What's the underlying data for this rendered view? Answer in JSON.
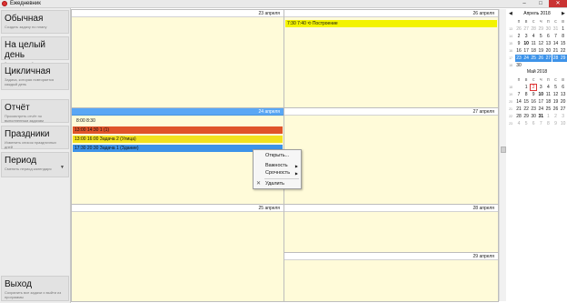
{
  "window": {
    "title": "Ежедневник",
    "min_label": "–",
    "max_label": "□",
    "close_label": "✕"
  },
  "sidebar": {
    "items": [
      {
        "title": "Обычная",
        "subtitle": "Создать задачу по плану"
      },
      {
        "title": "На целый день",
        "subtitle": "Задача на целый день"
      },
      {
        "title": "Цикличная",
        "subtitle": "Задача, которая повторяется каждый день"
      },
      {
        "title": "Отчёт",
        "subtitle": "Просмотреть отчёт по выполненным задачам"
      },
      {
        "title": "Праздники",
        "subtitle": "Изменить список праздничных дней"
      },
      {
        "title": "Период",
        "subtitle": "Сменить период календаря",
        "arrow": "▼"
      },
      {
        "title": "Выход",
        "subtitle": "Сохранить все задачи и выйти из программы"
      }
    ]
  },
  "days": {
    "d23": {
      "label": "23 апреля"
    },
    "d24": {
      "label": "24 апреля",
      "time_range": "8:00   8:30",
      "tasks": [
        {
          "text": "13:00 14:30 1 (1)",
          "color": "#e0542a"
        },
        {
          "text": "13:00 16:00 Задача 2 (Улица)",
          "color": "#f2e21f"
        },
        {
          "text": "17:30 20:30 Задача 1 (Здание)",
          "color": "#3d93e9"
        }
      ]
    },
    "d25": {
      "label": "25 апреля"
    },
    "d26": {
      "label": "26 апреля",
      "tasks": [
        {
          "text": "7:30   7:40 ⟲ Построение",
          "color": "#f3f300"
        }
      ]
    },
    "d27": {
      "label": "27 апреля"
    },
    "d28": {
      "label": "28 апреля"
    },
    "d29": {
      "label": "29 апреля"
    }
  },
  "context_menu": {
    "open": "Открыть...",
    "importance": "Важность",
    "urgency": "Срочность",
    "delete": "Удалить",
    "submenu_arrow": "▶",
    "delete_icon": "✕"
  },
  "mini_calendars": [
    {
      "title": "Апрель 2018",
      "prev": "◀",
      "next": "▶",
      "dow": [
        "п",
        "в",
        "с",
        "ч",
        "п",
        "с",
        "в"
      ],
      "weeks": [
        {
          "wk": "13",
          "days": [
            {
              "d": "26",
              "s": "gray"
            },
            {
              "d": "27",
              "s": "gray"
            },
            {
              "d": "28",
              "s": "gray"
            },
            {
              "d": "29",
              "s": "gray"
            },
            {
              "d": "30",
              "s": "gray"
            },
            {
              "d": "31",
              "s": "gray"
            },
            {
              "d": "1",
              "s": ""
            }
          ]
        },
        {
          "wk": "14",
          "days": [
            {
              "d": "2",
              "s": ""
            },
            {
              "d": "3",
              "s": ""
            },
            {
              "d": "4",
              "s": ""
            },
            {
              "d": "5",
              "s": ""
            },
            {
              "d": "6",
              "s": ""
            },
            {
              "d": "7",
              "s": ""
            },
            {
              "d": "8",
              "s": ""
            }
          ]
        },
        {
          "wk": "15",
          "days": [
            {
              "d": "9",
              "s": ""
            },
            {
              "d": "10",
              "s": "bold"
            },
            {
              "d": "11",
              "s": ""
            },
            {
              "d": "12",
              "s": ""
            },
            {
              "d": "13",
              "s": ""
            },
            {
              "d": "14",
              "s": ""
            },
            {
              "d": "15",
              "s": ""
            }
          ]
        },
        {
          "wk": "16",
          "days": [
            {
              "d": "16",
              "s": ""
            },
            {
              "d": "17",
              "s": ""
            },
            {
              "d": "18",
              "s": ""
            },
            {
              "d": "19",
              "s": ""
            },
            {
              "d": "20",
              "s": ""
            },
            {
              "d": "21",
              "s": ""
            },
            {
              "d": "22",
              "s": ""
            }
          ]
        },
        {
          "wk": "17",
          "days": [
            {
              "d": "23",
              "s": "sel"
            },
            {
              "d": "24",
              "s": "sel"
            },
            {
              "d": "25",
              "s": "sel"
            },
            {
              "d": "26",
              "s": "sel"
            },
            {
              "d": "27",
              "s": "sel"
            },
            {
              "d": "28",
              "s": "sel"
            },
            {
              "d": "29",
              "s": "sel"
            }
          ]
        },
        {
          "wk": "18",
          "days": [
            {
              "d": "30",
              "s": ""
            }
          ]
        }
      ]
    },
    {
      "title": "Май 2018",
      "dow": [
        "п",
        "в",
        "с",
        "ч",
        "п",
        "с",
        "в"
      ],
      "weeks": [
        {
          "wk": "18",
          "days": [
            {
              "d": "",
              "s": ""
            },
            {
              "d": "1",
              "s": ""
            },
            {
              "d": "2",
              "s": "today"
            },
            {
              "d": "3",
              "s": ""
            },
            {
              "d": "4",
              "s": ""
            },
            {
              "d": "5",
              "s": ""
            },
            {
              "d": "6",
              "s": ""
            }
          ]
        },
        {
          "wk": "19",
          "days": [
            {
              "d": "7",
              "s": ""
            },
            {
              "d": "8",
              "s": ""
            },
            {
              "d": "9",
              "s": ""
            },
            {
              "d": "10",
              "s": "bold"
            },
            {
              "d": "11",
              "s": ""
            },
            {
              "d": "12",
              "s": ""
            },
            {
              "d": "13",
              "s": ""
            }
          ]
        },
        {
          "wk": "20",
          "days": [
            {
              "d": "14",
              "s": ""
            },
            {
              "d": "15",
              "s": ""
            },
            {
              "d": "16",
              "s": ""
            },
            {
              "d": "17",
              "s": ""
            },
            {
              "d": "18",
              "s": ""
            },
            {
              "d": "19",
              "s": ""
            },
            {
              "d": "20",
              "s": ""
            }
          ]
        },
        {
          "wk": "21",
          "days": [
            {
              "d": "21",
              "s": ""
            },
            {
              "d": "22",
              "s": ""
            },
            {
              "d": "23",
              "s": ""
            },
            {
              "d": "24",
              "s": ""
            },
            {
              "d": "25",
              "s": ""
            },
            {
              "d": "26",
              "s": ""
            },
            {
              "d": "27",
              "s": ""
            }
          ]
        },
        {
          "wk": "22",
          "days": [
            {
              "d": "28",
              "s": ""
            },
            {
              "d": "29",
              "s": ""
            },
            {
              "d": "30",
              "s": ""
            },
            {
              "d": "31",
              "s": "bold"
            },
            {
              "d": "1",
              "s": "gray"
            },
            {
              "d": "2",
              "s": "gray"
            },
            {
              "d": "3",
              "s": "gray"
            }
          ]
        },
        {
          "wk": "23",
          "days": [
            {
              "d": "4",
              "s": "gray"
            },
            {
              "d": "5",
              "s": "gray"
            },
            {
              "d": "6",
              "s": "gray"
            },
            {
              "d": "7",
              "s": "gray"
            },
            {
              "d": "8",
              "s": "gray"
            },
            {
              "d": "9",
              "s": "gray"
            },
            {
              "d": "10",
              "s": "gray"
            }
          ]
        }
      ]
    }
  ],
  "colors": {
    "selected_header": "#5aa7f5",
    "cell_bg": "#fffbd9",
    "accent": "#3d93e9"
  }
}
